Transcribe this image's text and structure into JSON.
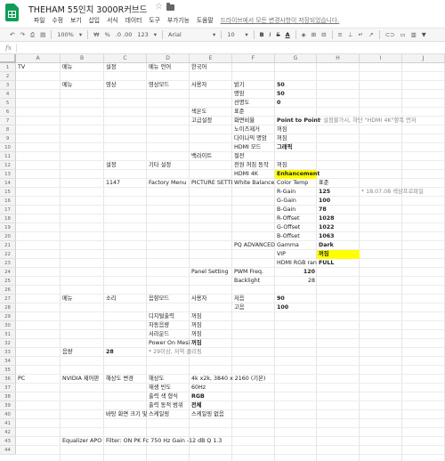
{
  "title": "THEHAM 55인치 3000R커브드",
  "menu": [
    "파일",
    "수정",
    "보기",
    "삽입",
    "서식",
    "데이터",
    "도구",
    "부가기능",
    "도움말"
  ],
  "save_status": "드라이브에서 모든 변경사항이 저장되었습니다.",
  "toolbar": {
    "zoom": "100%",
    "currency": "₩",
    "percent": "%",
    "decimal": ".0  .00",
    "format": "123",
    "font": "Arial",
    "size": "10",
    "bold": "B",
    "italic": "I",
    "strike": "S",
    "text_color": "A"
  },
  "columns": [
    "A",
    "B",
    "C",
    "D",
    "E",
    "F",
    "G",
    "H",
    "I",
    "J"
  ],
  "rows": [
    "1",
    "2",
    "3",
    "4",
    "5",
    "6",
    "7",
    "8",
    "9",
    "10",
    "11",
    "12",
    "13",
    "14",
    "15",
    "16",
    "17",
    "18",
    "19",
    "20",
    "21",
    "22",
    "23",
    "24",
    "25",
    "26",
    "27",
    "28",
    "29",
    "30",
    "31",
    "32",
    "33",
    "34",
    "35",
    "36",
    "37",
    "38",
    "39",
    "40",
    "41",
    "42",
    "43",
    "44"
  ],
  "cells": [
    {
      "r": 1,
      "c": 0,
      "v": "TV"
    },
    {
      "r": 1,
      "c": 1,
      "v": "메뉴"
    },
    {
      "r": 1,
      "c": 2,
      "v": "설정"
    },
    {
      "r": 1,
      "c": 3,
      "v": "메뉴 언어"
    },
    {
      "r": 1,
      "c": 4,
      "v": "한국어"
    },
    {
      "r": 3,
      "c": 1,
      "v": "메뉴"
    },
    {
      "r": 3,
      "c": 2,
      "v": "영상"
    },
    {
      "r": 3,
      "c": 3,
      "v": "영상모드"
    },
    {
      "r": 3,
      "c": 4,
      "v": "사용자"
    },
    {
      "r": 3,
      "c": 5,
      "v": "밝기"
    },
    {
      "r": 3,
      "c": 6,
      "v": "50",
      "b": true
    },
    {
      "r": 4,
      "c": 5,
      "v": "명암"
    },
    {
      "r": 4,
      "c": 6,
      "v": "50",
      "b": true
    },
    {
      "r": 5,
      "c": 5,
      "v": "선명도"
    },
    {
      "r": 5,
      "c": 6,
      "v": "0",
      "b": true
    },
    {
      "r": 6,
      "c": 4,
      "v": "색온도"
    },
    {
      "r": 6,
      "c": 5,
      "v": "표준"
    },
    {
      "r": 7,
      "c": 4,
      "v": "고급설정"
    },
    {
      "r": 7,
      "c": 5,
      "v": "화면비율"
    },
    {
      "r": 7,
      "c": 6,
      "v": "Point to Point",
      "b": true,
      "span": "F"
    },
    {
      "r": 7,
      "c": 7,
      "v": "* 설정불가시, 하단 \"HDMI 4K\"항목 먼저",
      "g": true
    },
    {
      "r": 8,
      "c": 5,
      "v": "노이즈제거"
    },
    {
      "r": 8,
      "c": 6,
      "v": "꺼짐"
    },
    {
      "r": 9,
      "c": 5,
      "v": "다이나믹 명암"
    },
    {
      "r": 9,
      "c": 6,
      "v": "꺼짐"
    },
    {
      "r": 10,
      "c": 5,
      "v": "HDMI 모드"
    },
    {
      "r": 10,
      "c": 6,
      "v": "그래픽",
      "b": true
    },
    {
      "r": 11,
      "c": 4,
      "v": "백라이트"
    },
    {
      "r": 11,
      "c": 5,
      "v": "절전"
    },
    {
      "r": 12,
      "c": 2,
      "v": "설정"
    },
    {
      "r": 12,
      "c": 3,
      "v": "기타 설정"
    },
    {
      "r": 12,
      "c": 5,
      "v": "전원 꺼짐 동작"
    },
    {
      "r": 12,
      "c": 6,
      "v": "꺼짐"
    },
    {
      "r": 13,
      "c": 5,
      "v": "HDMI 4K"
    },
    {
      "r": 13,
      "c": 6,
      "v": "Enhancement",
      "b": true,
      "y": true
    },
    {
      "r": 14,
      "c": 2,
      "v": "1147"
    },
    {
      "r": 14,
      "c": 3,
      "v": "Factory Menu"
    },
    {
      "r": 14,
      "c": 4,
      "v": "PICTURE SETTING",
      "clip": true
    },
    {
      "r": 14,
      "c": 5,
      "v": "White Balance"
    },
    {
      "r": 14,
      "c": 6,
      "v": "Color Temp"
    },
    {
      "r": 14,
      "c": 7,
      "v": "표준"
    },
    {
      "r": 15,
      "c": 6,
      "v": "R-Gain"
    },
    {
      "r": 15,
      "c": 7,
      "v": "125",
      "b": true
    },
    {
      "r": 15,
      "c": 8,
      "v": "* 18.07.08 색상프로파일",
      "g": true
    },
    {
      "r": 16,
      "c": 6,
      "v": "G-Gain"
    },
    {
      "r": 16,
      "c": 7,
      "v": "100",
      "b": true
    },
    {
      "r": 17,
      "c": 6,
      "v": "B-Gain"
    },
    {
      "r": 17,
      "c": 7,
      "v": "78",
      "b": true
    },
    {
      "r": 18,
      "c": 6,
      "v": "R-Offset"
    },
    {
      "r": 18,
      "c": 7,
      "v": "1028",
      "b": true
    },
    {
      "r": 19,
      "c": 6,
      "v": "G-Offset"
    },
    {
      "r": 19,
      "c": 7,
      "v": "1022",
      "b": true
    },
    {
      "r": 20,
      "c": 6,
      "v": "B-Offset"
    },
    {
      "r": 20,
      "c": 7,
      "v": "1063",
      "b": true
    },
    {
      "r": 21,
      "c": 5,
      "v": "PQ ADVANCED"
    },
    {
      "r": 21,
      "c": 6,
      "v": "Gamma"
    },
    {
      "r": 21,
      "c": 7,
      "v": "Dark",
      "b": true
    },
    {
      "r": 22,
      "c": 6,
      "v": "VIP"
    },
    {
      "r": 22,
      "c": 7,
      "v": "꺼짐",
      "b": true,
      "y": true
    },
    {
      "r": 23,
      "c": 6,
      "v": "HDMI RGB range",
      "clip": true
    },
    {
      "r": 23,
      "c": 7,
      "v": "FULL",
      "b": true
    },
    {
      "r": 24,
      "c": 4,
      "v": "Panel Setting"
    },
    {
      "r": 24,
      "c": 5,
      "v": "PWM Freq."
    },
    {
      "r": 24,
      "c": 6,
      "v": "120",
      "b": true,
      "right": true
    },
    {
      "r": 25,
      "c": 5,
      "v": "Backlight"
    },
    {
      "r": 25,
      "c": 6,
      "v": "28",
      "right": true
    },
    {
      "r": 27,
      "c": 1,
      "v": "메뉴"
    },
    {
      "r": 27,
      "c": 2,
      "v": "소리"
    },
    {
      "r": 27,
      "c": 3,
      "v": "음향모드"
    },
    {
      "r": 27,
      "c": 4,
      "v": "사용자"
    },
    {
      "r": 27,
      "c": 5,
      "v": "저음"
    },
    {
      "r": 27,
      "c": 6,
      "v": "90",
      "b": true
    },
    {
      "r": 28,
      "c": 5,
      "v": "고음"
    },
    {
      "r": 28,
      "c": 6,
      "v": "100",
      "b": true
    },
    {
      "r": 29,
      "c": 3,
      "v": "디지털출력"
    },
    {
      "r": 29,
      "c": 4,
      "v": "꺼짐"
    },
    {
      "r": 30,
      "c": 3,
      "v": "자동음량"
    },
    {
      "r": 30,
      "c": 4,
      "v": "꺼짐"
    },
    {
      "r": 31,
      "c": 3,
      "v": "서라운드"
    },
    {
      "r": 31,
      "c": 4,
      "v": "꺼짐"
    },
    {
      "r": 32,
      "c": 3,
      "v": "Power On Mesic",
      "clip": true
    },
    {
      "r": 32,
      "c": 4,
      "v": "꺼짐",
      "b": true
    },
    {
      "r": 33,
      "c": 1,
      "v": "음량"
    },
    {
      "r": 33,
      "c": 2,
      "v": "28",
      "b": true
    },
    {
      "r": 33,
      "c": 3,
      "v": "* 29이상, 저역 클리핑",
      "g": true
    },
    {
      "r": 36,
      "c": 0,
      "v": "PC"
    },
    {
      "r": 36,
      "c": 1,
      "v": "NVIDIA 제어판"
    },
    {
      "r": 36,
      "c": 2,
      "v": "해상도 변경"
    },
    {
      "r": 36,
      "c": 3,
      "v": "해상도"
    },
    {
      "r": 36,
      "c": 4,
      "v": "4k x2k, 3840 x 2160 (기본)"
    },
    {
      "r": 37,
      "c": 3,
      "v": "재생 빈도"
    },
    {
      "r": 37,
      "c": 4,
      "v": "60Hz"
    },
    {
      "r": 38,
      "c": 3,
      "v": "출력 색 형식"
    },
    {
      "r": 38,
      "c": 4,
      "v": "RGB",
      "b": true
    },
    {
      "r": 39,
      "c": 3,
      "v": "출력 동적 범위"
    },
    {
      "r": 39,
      "c": 4,
      "v": "전체",
      "b": true
    },
    {
      "r": 40,
      "c": 2,
      "v": "바탕 화면 크기 및 위치 조정",
      "clip": true
    },
    {
      "r": 40,
      "c": 3,
      "v": "스케일링"
    },
    {
      "r": 40,
      "c": 4,
      "v": "스케일링 없음"
    },
    {
      "r": 43,
      "c": 1,
      "v": "Equalizer APO"
    },
    {
      "r": 43,
      "c": 2,
      "v": "Filter: ON PK Fc 750 Hz Gain -12 dB Q 1.3"
    }
  ]
}
